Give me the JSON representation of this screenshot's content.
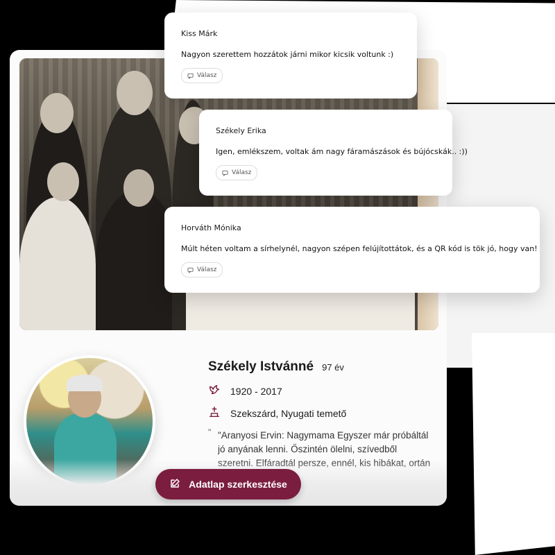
{
  "memorial": {
    "name": "Székely Istvánné",
    "age": "97 év",
    "years": "1920 - 2017",
    "place": "Szekszárd, Nyugati temető",
    "quote_mark": "\"",
    "quote": "\"Aranyosi Ervin: Nagymama Egyszer már próbáltál jó anyának lenni. Őszintén ölelni, szívedből szeretni. Elfáradtál persze, ennél, kis hibákat, ortán hullt a",
    "edit_button": "Adatlap szerkesztése",
    "icons": {
      "years": "dove-icon",
      "place": "grave-icon",
      "edit": "edit-icon"
    },
    "colors": {
      "accent": "#7b1d3e"
    }
  },
  "comments": [
    {
      "author": "Kiss Márk",
      "text": "Nagyon szerettem hozzátok járni mikor kicsik voltunk :)",
      "reply": "Válasz"
    },
    {
      "author": "Székely Erika",
      "text": "Igen, emlékszem, voltak ám nagy fáramászások és bújócskák.. :))",
      "reply": "Válasz"
    },
    {
      "author": "Horváth Mónika",
      "text": "Múlt héten voltam a sírhelynél, nagyon szépen felújítottátok, és a QR kód is tök jó, hogy van!",
      "reply": "Válasz"
    }
  ]
}
